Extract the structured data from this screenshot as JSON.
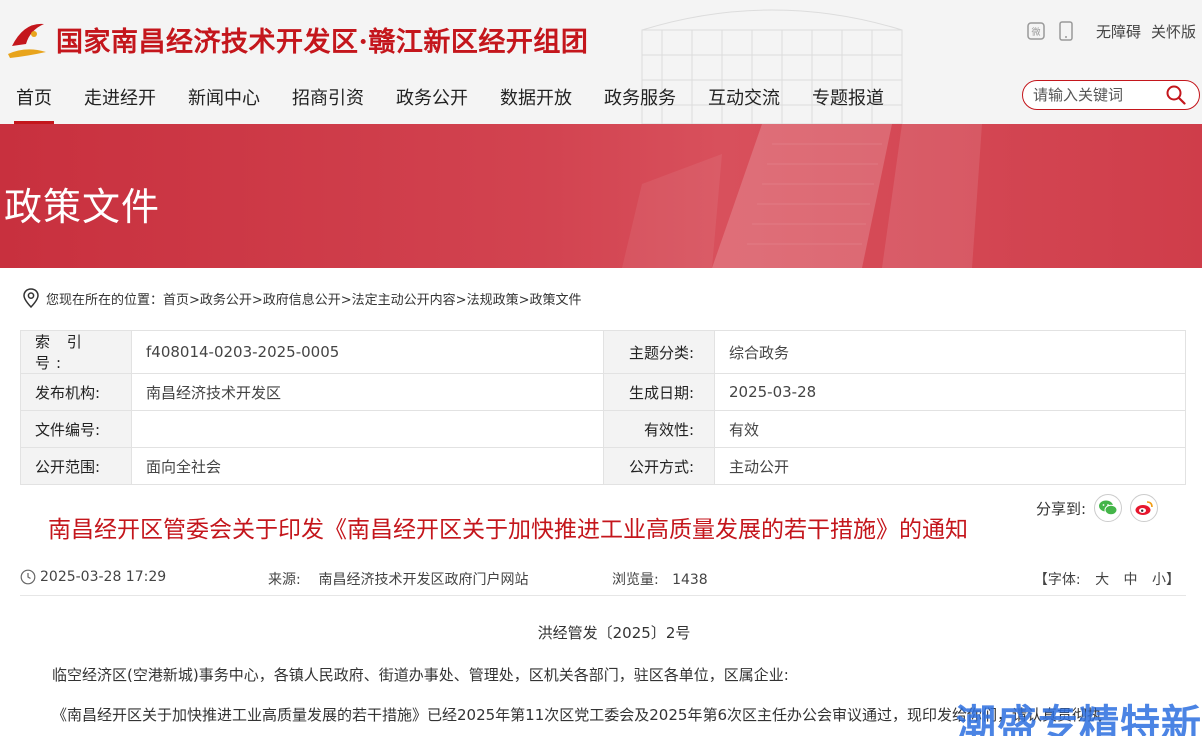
{
  "header": {
    "site_title": "国家南昌经济技术开发区·赣江新区经开组团",
    "tools": {
      "accessibility": "无障碍",
      "elderly": "关怀版"
    }
  },
  "nav": {
    "items": [
      "首页",
      "走进经开",
      "新闻中心",
      "招商引资",
      "政务公开",
      "数据开放",
      "政务服务",
      "互动交流",
      "专题报道"
    ],
    "active_index": 0
  },
  "search": {
    "placeholder": "请输入关键词"
  },
  "banner": {
    "title": "政策文件"
  },
  "breadcrumb": {
    "text": "您现在所在的位置：首页>政务公开>政府信息公开>法定主动公开内容>法规政策>政策文件"
  },
  "meta": {
    "index_label": "索 引 号:",
    "index_value": "f408014-0203-2025-0005",
    "topic_label": "主题分类:",
    "topic_value": "综合政务",
    "org_label": "发布机构:",
    "org_value": "南昌经济技术开发区",
    "date_label": "生成日期:",
    "date_value": "2025-03-28",
    "docno_label": "文件编号:",
    "docno_value": "",
    "valid_label": "有效性:",
    "valid_value": "有效",
    "scope_label": "公开范围:",
    "scope_value": "面向全社会",
    "mode_label": "公开方式:",
    "mode_value": "主动公开"
  },
  "share": {
    "label": "分享到:"
  },
  "article": {
    "title": "南昌经开区管委会关于印发《南昌经开区关于加快推进工业高质量发展的若干措施》的通知",
    "date": "2025-03-28 17:29",
    "source_label": "来源:",
    "source": "南昌经济技术开发区政府门户网站",
    "views_label": "浏览量:",
    "views": "1438",
    "font_label": "【字体:",
    "font_large": "大",
    "font_medium": "中",
    "font_small": "小】",
    "doc_number": "洪经管发〔2025〕2号",
    "para1": "临空经济区(空港新城)事务中心，各镇人民政府、街道办事处、管理处，区机关各部门，驻区各单位，区属企业:",
    "para2": "《南昌经开区关于加快推进工业高质量发展的若干措施》已经2025年第11次区党工委会及2025年第6次区主任办公会审议通过，现印发给你们，请认真贯彻执"
  },
  "watermark": {
    "text": "潮盛专精特新"
  },
  "colors": {
    "brand_red": "#c4161c",
    "banner_red": "#d04350",
    "watermark_blue": "#2c6fe0"
  }
}
